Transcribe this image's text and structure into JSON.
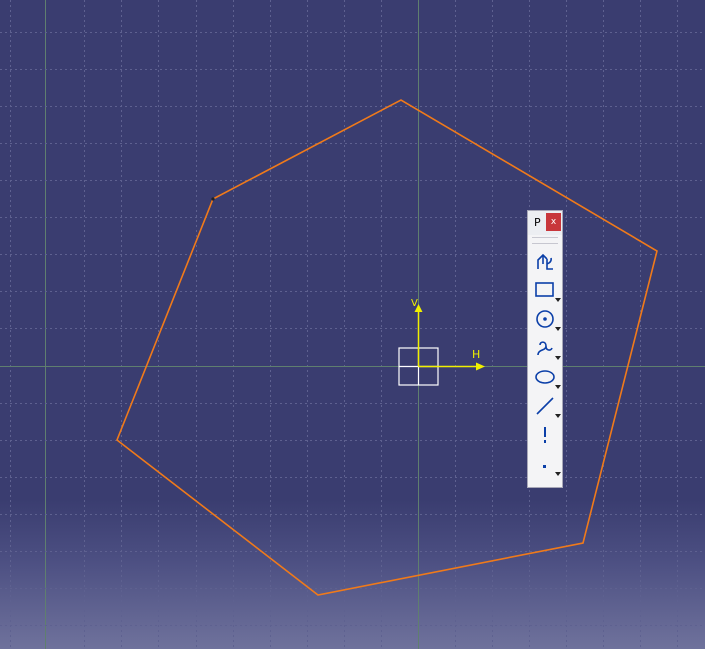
{
  "colors": {
    "background": "#3a3d70",
    "grid": "#5e6190",
    "grid_major": "#5f7f6f",
    "profile": "#f07a1a",
    "axis": "#f0f000",
    "origin_box": "#ffffff"
  },
  "axes": {
    "h_label": "H",
    "v_label": "V"
  },
  "toolbar": {
    "title": "P",
    "close_label": "x",
    "tools": [
      {
        "name": "profile-tool",
        "icon": "profile-icon",
        "has_dropdown": false
      },
      {
        "name": "rectangle-tool",
        "icon": "rectangle-icon",
        "has_dropdown": true
      },
      {
        "name": "circle-tool",
        "icon": "circle-icon",
        "has_dropdown": true
      },
      {
        "name": "spline-tool",
        "icon": "spline-icon",
        "has_dropdown": true
      },
      {
        "name": "ellipse-tool",
        "icon": "ellipse-icon",
        "has_dropdown": true
      },
      {
        "name": "line-tool",
        "icon": "line-icon",
        "has_dropdown": true
      },
      {
        "name": "axis-tool",
        "icon": "axis-icon",
        "has_dropdown": false
      },
      {
        "name": "point-tool",
        "icon": "point-icon",
        "has_dropdown": true
      }
    ]
  }
}
